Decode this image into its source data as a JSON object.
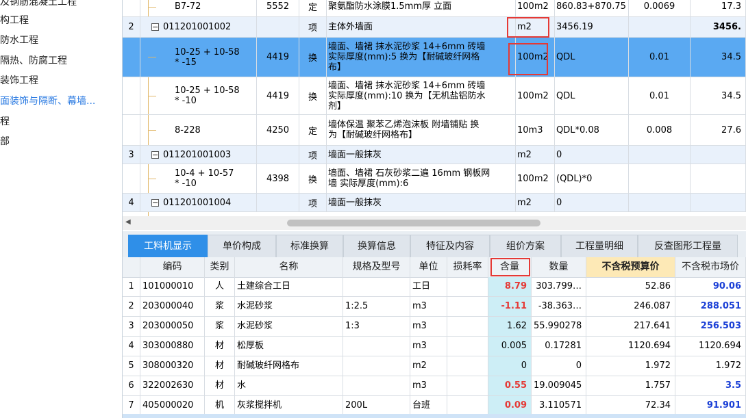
{
  "sidebar": {
    "items": [
      {
        "label": "及钢筋混凝土工程",
        "active": false
      },
      {
        "label": "构工程",
        "active": false
      },
      {
        "label": "防水工程",
        "active": false
      },
      {
        "label": "隔热、防腐工程",
        "active": false
      },
      {
        "label": "装饰工程",
        "active": false
      },
      {
        "label": "面装饰与隔断、幕墙...",
        "active": true
      },
      {
        "label": "程",
        "active": false
      },
      {
        "label": "部",
        "active": false
      }
    ]
  },
  "top_grid": {
    "rows": [
      {
        "num": "",
        "code": "B7-72",
        "col3": "5552",
        "type": "定",
        "name": "聚氨酯防水涂膜1.5mm厚 立面",
        "unit": "100m2",
        "expr": "860.83+870.75",
        "qty": "0.0069",
        "amount": "17.3",
        "level": "sub"
      },
      {
        "num": "2",
        "code": "011201001002",
        "col3": "",
        "type": "项",
        "name": "主体外墙面",
        "unit": "m2",
        "expr": "3456.19",
        "qty": "",
        "amount": "3456.",
        "level": "item"
      },
      {
        "num": "",
        "code": "10-25 + 10-58\n* -15",
        "col3": "4419",
        "type": "换",
        "name": "墙面、墙裙 抹水泥砂浆 14+6mm 砖墙\n实际厚度(mm):5  换为【耐碱玻纤网格\n布】",
        "unit": "100m2",
        "expr": "QDL",
        "qty": "0.01",
        "amount": "34.5",
        "level": "sub"
      },
      {
        "num": "",
        "code": "10-25 + 10-58\n* -10",
        "col3": "4419",
        "type": "换",
        "name": "墙面、墙裙 抹水泥砂浆 14+6mm 砖墙\n实际厚度(mm):10  换为【无机盐铝防水\n剂】",
        "unit": "100m2",
        "expr": "QDL",
        "qty": "0.01",
        "amount": "34.5",
        "level": "sub"
      },
      {
        "num": "",
        "code": "8-228",
        "col3": "4250",
        "type": "定",
        "name": "墙体保温 聚苯乙烯泡沫板 附墙铺贴  换\n为【耐碱玻纤网格布】",
        "unit": "10m3",
        "expr": "QDL*0.08",
        "qty": "0.008",
        "amount": "27.6",
        "level": "sub"
      },
      {
        "num": "3",
        "code": "011201001003",
        "col3": "",
        "type": "项",
        "name": "墙面一般抹灰",
        "unit": "m2",
        "expr": "0",
        "qty": "",
        "amount": "",
        "level": "item"
      },
      {
        "num": "",
        "code": "10-4 + 10-57\n* -10",
        "col3": "4398",
        "type": "换",
        "name": "墙面、墙裙 石灰砂浆二遍 16mm 钢板网\n墙  实际厚度(mm):6",
        "unit": "100m2",
        "expr": "(QDL)*0",
        "qty": "",
        "amount": "",
        "level": "sub"
      },
      {
        "num": "4",
        "code": "011201001004",
        "col3": "",
        "type": "项",
        "name": "墙面一般抹灰",
        "unit": "m2",
        "expr": "0",
        "qty": "",
        "amount": "",
        "level": "item"
      }
    ]
  },
  "tabs": [
    {
      "label": "工料机显示",
      "active": true
    },
    {
      "label": "单价构成",
      "active": false
    },
    {
      "label": "标准换算",
      "active": false
    },
    {
      "label": "换算信息",
      "active": false
    },
    {
      "label": "特征及内容",
      "active": false
    },
    {
      "label": "组价方案",
      "active": false
    },
    {
      "label": "工程量明细",
      "active": false
    },
    {
      "label": "反查图形工程量",
      "active": false
    }
  ],
  "bottom_grid": {
    "headers": [
      "编码",
      "类别",
      "名称",
      "规格及型号",
      "单位",
      "损耗率",
      "含量",
      "数量",
      "不含税预算价",
      "不含税市场价"
    ],
    "rows": [
      {
        "num": "1",
        "code": "101000010",
        "cat": "人",
        "name": "土建综合工日",
        "spec": "",
        "unit": "工日",
        "loss": "",
        "content": "8.79",
        "content_red": true,
        "qty": "303.799…",
        "budget": "52.86",
        "market": "90.06",
        "market_blue": true
      },
      {
        "num": "2",
        "code": "203000040",
        "cat": "浆",
        "name": "水泥砂浆",
        "spec": "1:2.5",
        "unit": "m3",
        "loss": "",
        "content": "-1.11",
        "content_red": true,
        "qty": "-38.363…",
        "budget": "246.087",
        "market": "288.051",
        "market_blue": true
      },
      {
        "num": "3",
        "code": "203000050",
        "cat": "浆",
        "name": "水泥砂浆",
        "spec": "1:3",
        "unit": "m3",
        "loss": "",
        "content": "1.62",
        "content_red": false,
        "qty": "55.990278",
        "budget": "217.641",
        "market": "256.503",
        "market_blue": true
      },
      {
        "num": "4",
        "code": "303000880",
        "cat": "材",
        "name": "松厚板",
        "spec": "",
        "unit": "m3",
        "loss": "",
        "content": "0.005",
        "content_red": false,
        "qty": "0.17281",
        "budget": "1120.694",
        "market": "1120.694",
        "market_blue": false
      },
      {
        "num": "5",
        "code": "308000320",
        "cat": "材",
        "name": "耐碱玻纤网格布",
        "spec": "",
        "unit": "m2",
        "loss": "",
        "content": "0",
        "content_red": false,
        "qty": "0",
        "budget": "1.972",
        "market": "1.972",
        "market_blue": false
      },
      {
        "num": "6",
        "code": "322002630",
        "cat": "材",
        "name": "水",
        "spec": "",
        "unit": "m3",
        "loss": "",
        "content": "0.55",
        "content_red": true,
        "qty": "19.009045",
        "budget": "1.757",
        "market": "3.5",
        "market_blue": true
      },
      {
        "num": "7",
        "code": "405000020",
        "cat": "机",
        "name": "灰浆搅拌机",
        "spec": "200L",
        "unit": "台班",
        "loss": "",
        "content": "0.09",
        "content_red": true,
        "qty": "3.110571",
        "budget": "72.34",
        "market": "91.901",
        "market_blue": true
      }
    ]
  },
  "colors": {
    "accent": "#2f8fe8",
    "selected_row": "#5aa9f2",
    "highlight_red": "#e53935",
    "market_blue": "#1a3fd6"
  }
}
